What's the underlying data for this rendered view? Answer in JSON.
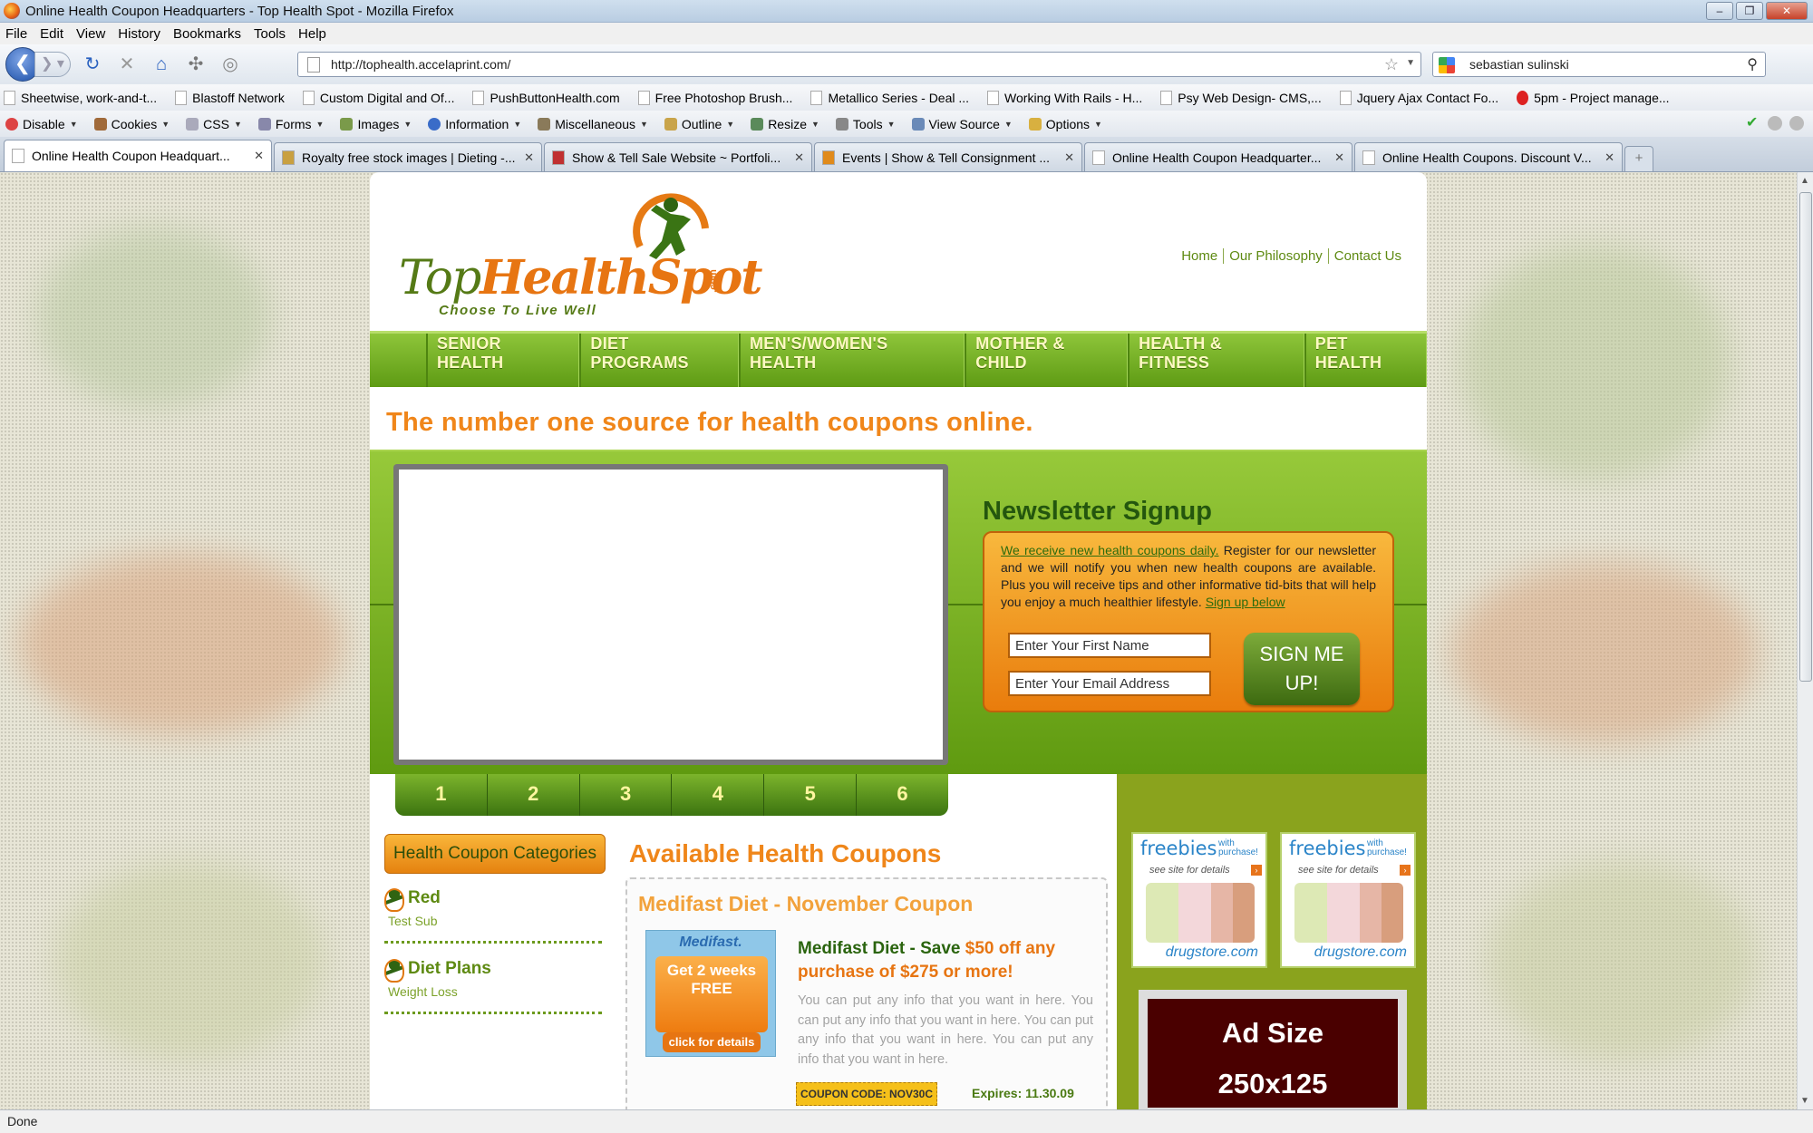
{
  "window": {
    "title": "Online Health Coupon Headquarters - Top Health Spot - Mozilla Firefox"
  },
  "menu": [
    "File",
    "Edit",
    "View",
    "History",
    "Bookmarks",
    "Tools",
    "Help"
  ],
  "nav": {
    "url": "http://tophealth.accelaprint.com/",
    "search": "sebastian sulinski"
  },
  "bookmarks": [
    "Sheetwise, work-and-t...",
    "Blastoff Network",
    "Custom Digital and Of...",
    "PushButtonHealth.com",
    "Free Photoshop Brush...",
    "Metallico Series - Deal ...",
    "Working With Rails - H...",
    "Psy Web Design- CMS,...",
    "Jquery Ajax Contact Fo...",
    "5pm - Project manage..."
  ],
  "webdev": [
    "Disable",
    "Cookies",
    "CSS",
    "Forms",
    "Images",
    "Information",
    "Miscellaneous",
    "Outline",
    "Resize",
    "Tools",
    "View Source",
    "Options"
  ],
  "tabs": [
    "Online Health Coupon Headquart...",
    "Royalty free stock images | Dieting -...",
    "Show & Tell Sale Website ~ Portfoli...",
    "Events | Show & Tell Consignment ...",
    "Online Health Coupon Headquarter...",
    "Online Health Coupons. Discount V..."
  ],
  "status": "Done",
  "site": {
    "logo": {
      "top": "Top",
      "health": "HealthSpot",
      "com": ".com",
      "tagline": "Choose To Live Well"
    },
    "toplinks": [
      "Home",
      "Our Philosophy",
      "Contact Us"
    ],
    "mainnav": [
      "SENIOR HEALTH",
      "DIET PROGRAMS",
      "MEN'S/WOMEN'S HEALTH",
      "MOTHER & CHILD",
      "HEALTH & FITNESS",
      "PET HEALTH"
    ],
    "tagline": "The number one source for health coupons online.",
    "newsletter": {
      "title": "Newsletter Signup",
      "link": "We receive new health coupons daily.",
      "body": " Register for our newsletter and we will notify you when new health coupons are available. Plus you will receive tips and other informative tid-bits that will help you enjoy a much healthier lifestyle. ",
      "signup": "Sign up below",
      "first_name": "Enter Your First Name",
      "email": "Enter Your Email Address",
      "button": "SIGN ME UP!"
    },
    "pager": [
      "1",
      "2",
      "3",
      "4",
      "5",
      "6"
    ],
    "categories": {
      "title": "Health Coupon Categories",
      "items": [
        {
          "name": "Red",
          "sub": "Test Sub"
        },
        {
          "name": "Diet Plans",
          "sub": "Weight Loss"
        }
      ]
    },
    "coupons": {
      "title": "Available Health Coupons",
      "item": {
        "title": "Medifast Diet - November Coupon",
        "image": {
          "brand": "Medifast.",
          "offer": "Get 2 weeks FREE",
          "cta": "click for details"
        },
        "headline_a": "Medifast Diet - Save ",
        "headline_b": "$50 off any purchase of $275 or more!",
        "desc": "You can put any info that you want in here. You can put any info that you want in here. You can put any info that you want in here. You can put any info that you want in here.",
        "code": "COUPON CODE: NOV30C",
        "expires": "Expires: 11.30.09"
      }
    },
    "freebies": {
      "title": "freebies",
      "with": "with purchase!",
      "see": "see site for details",
      "brand": "drugstore.com"
    },
    "ad": {
      "line1": "Ad Size",
      "line2": "250x125"
    }
  }
}
